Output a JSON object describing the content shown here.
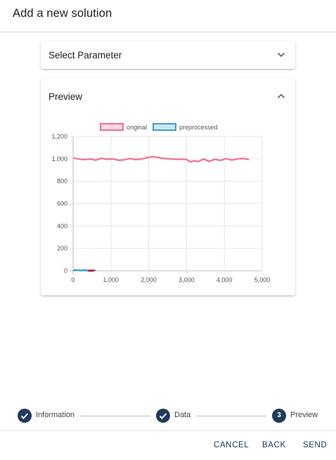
{
  "dialog": {
    "title": "Add a new solution"
  },
  "parameter_panel": {
    "label": "Select Parameter",
    "icon": "chevron-down-icon",
    "expanded": false
  },
  "preview_panel": {
    "label": "Preview",
    "icon": "chevron-up-icon",
    "expanded": true
  },
  "chart_data": {
    "type": "line",
    "title": "",
    "xlabel": "",
    "ylabel": "",
    "xlim": [
      0,
      5000
    ],
    "ylim": [
      0,
      1200
    ],
    "x_ticks": [
      "0",
      "1,000",
      "2,000",
      "3,000",
      "4,000",
      "5,000"
    ],
    "y_ticks": [
      "0",
      "200",
      "400",
      "600",
      "800",
      "1,000",
      "1,200"
    ],
    "grid": true,
    "legend_position": "top",
    "series": [
      {
        "name": "original",
        "color": "#ef6f8e",
        "x": [
          0,
          150,
          300,
          450,
          600,
          750,
          900,
          1050,
          1200,
          1350,
          1500,
          1650,
          1800,
          1950,
          2100,
          2250,
          2400,
          2550,
          2700,
          2850,
          3000,
          3100,
          3200,
          3300,
          3450,
          3600,
          3750,
          3900,
          4050,
          4200,
          4350,
          4500,
          4650
        ],
        "y": [
          1008,
          998,
          993,
          999,
          988,
          1006,
          996,
          1000,
          987,
          991,
          1003,
          993,
          998,
          1010,
          1019,
          1013,
          1003,
          1000,
          996,
          997,
          994,
          974,
          983,
          976,
          998,
          978,
          996,
          986,
          1002,
          988,
          1000,
          1003,
          994
        ]
      },
      {
        "name": "preprocessed",
        "color": "#3d9fd8",
        "x": [
          0,
          100,
          200,
          300,
          400,
          500,
          600
        ],
        "y": [
          4,
          6,
          3,
          5,
          2,
          4,
          3
        ]
      },
      {
        "name": "",
        "color": "#d0021b",
        "x": [
          400,
          450,
          500,
          550
        ],
        "y": [
          0,
          1,
          0,
          1
        ]
      }
    ]
  },
  "stepper": {
    "steps": [
      {
        "label": "Information",
        "state": "done",
        "icon": "check-icon"
      },
      {
        "label": "Data",
        "state": "done",
        "icon": "check-icon"
      },
      {
        "label": "Preview",
        "state": "active",
        "number": "3"
      }
    ]
  },
  "footer": {
    "cancel": "CANCEL",
    "back": "BACK",
    "send": "SEND"
  },
  "colors": {
    "primary": "#223a5e",
    "accent_original": "#ef6f8e",
    "accent_preprocessed": "#3d9fd8"
  }
}
